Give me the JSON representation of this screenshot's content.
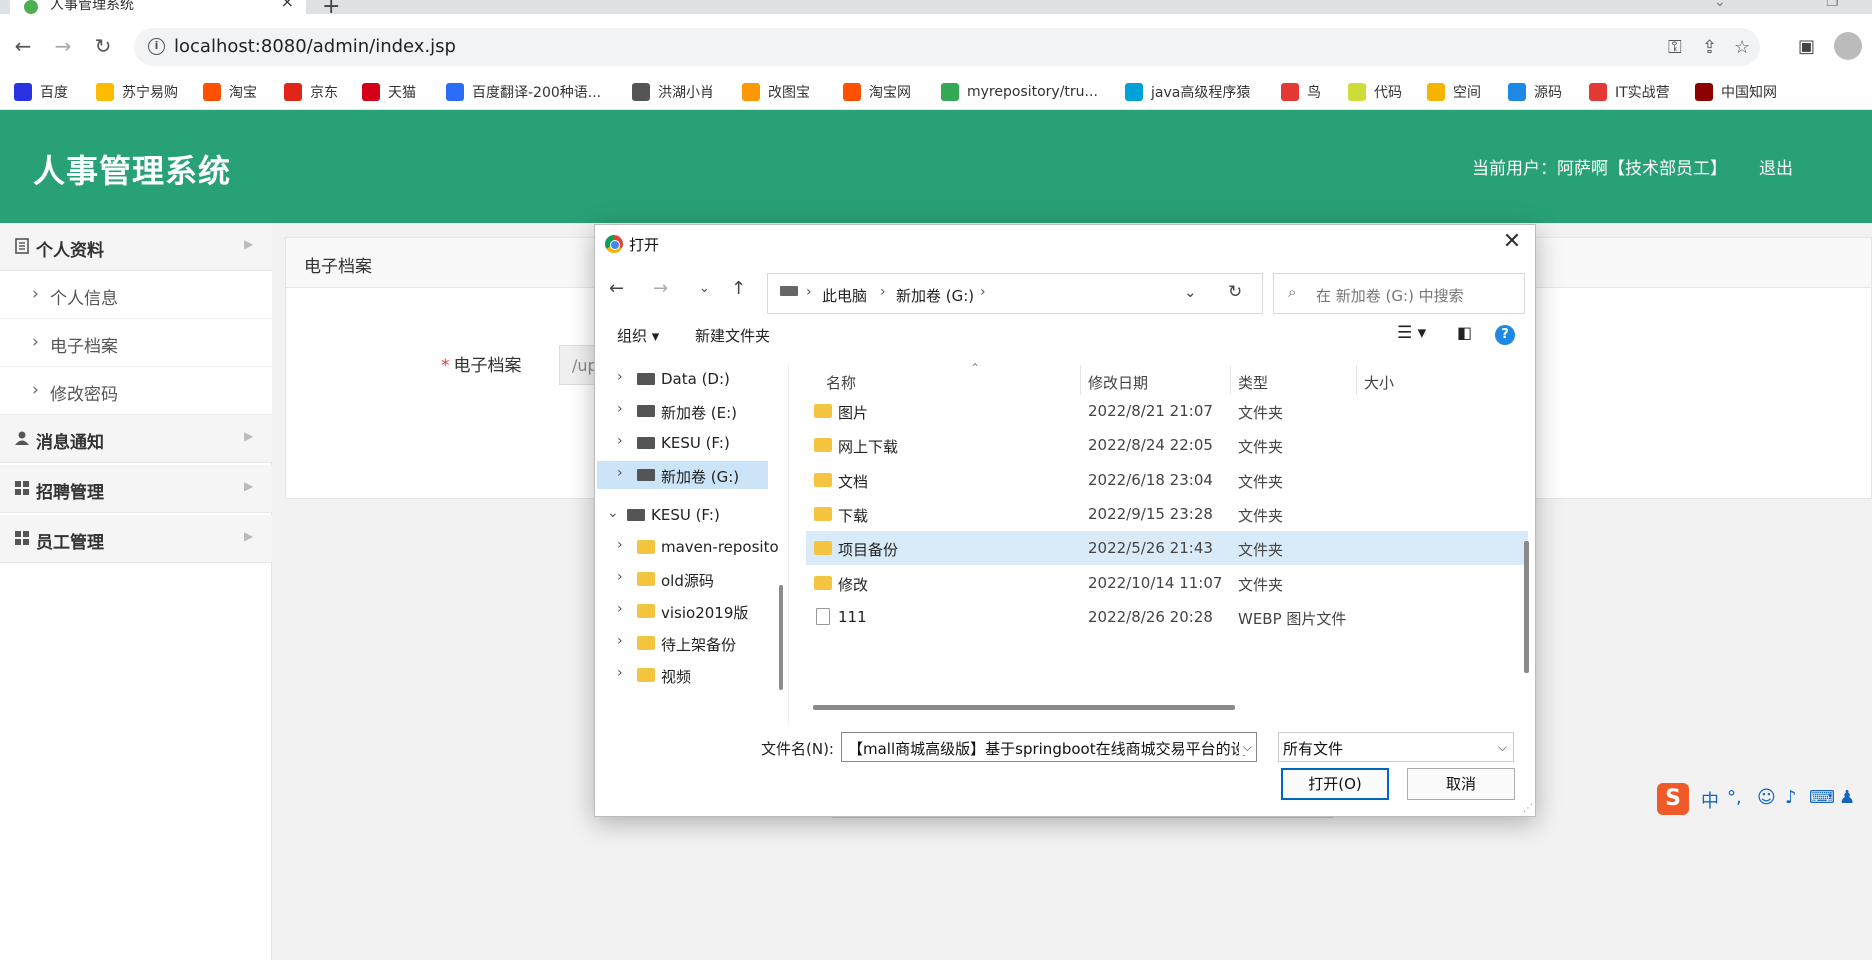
{
  "browser": {
    "tab_title": "人事管理系统",
    "tab_close": "×",
    "new_tab": "+",
    "url": "localhost:8080/admin/index.jsp",
    "bookmarks": [
      {
        "label": "百度",
        "color": "#2932e1"
      },
      {
        "label": "苏宁易购",
        "color": "#ffbb00"
      },
      {
        "label": "淘宝",
        "color": "#ff5000"
      },
      {
        "label": "京东",
        "color": "#e1251b"
      },
      {
        "label": "天猫",
        "color": "#d4001a"
      },
      {
        "label": "百度翻译-200种语...",
        "color": "#2b6cf6"
      },
      {
        "label": "洪湖小肖",
        "color": "#555555"
      },
      {
        "label": "改图宝",
        "color": "#ff9800"
      },
      {
        "label": "淘宝网",
        "color": "#ff5000"
      },
      {
        "label": "myrepository/tru...",
        "color": "#34a853"
      },
      {
        "label": "java高级程序猿",
        "color": "#00a1d6"
      },
      {
        "label": "鸟",
        "color": "#e53935"
      },
      {
        "label": "代码",
        "color": "#cddc39"
      },
      {
        "label": "空间",
        "color": "#f4b400"
      },
      {
        "label": "源码",
        "color": "#1e88e5"
      },
      {
        "label": "IT实战营",
        "color": "#e53935"
      },
      {
        "label": "中国知网",
        "color": "#8b0000"
      }
    ]
  },
  "app": {
    "title": "人事管理系统",
    "current_user": "当前用户：阿萨啊【技术部员工】",
    "logout": "退出",
    "accent": "#29a176"
  },
  "sidebar": {
    "groups": [
      {
        "label": "个人资料",
        "icon": "profile-icon"
      },
      {
        "label": "消息通知",
        "icon": "user-icon"
      },
      {
        "label": "招聘管理",
        "icon": "grid-icon"
      },
      {
        "label": "员工管理",
        "icon": "grid-icon"
      }
    ],
    "items": [
      {
        "label": "个人信息"
      },
      {
        "label": "电子档案"
      },
      {
        "label": "修改密码"
      }
    ]
  },
  "main": {
    "panel_title": "电子档案",
    "field_required_mark": "*",
    "field_label": "电子档案",
    "field_value": "/up"
  },
  "dialog": {
    "title": "打开",
    "breadcrumb": [
      "此电脑",
      "新加卷 (G:)"
    ],
    "search_placeholder": "在 新加卷 (G:) 中搜索",
    "organize": "组织 ▾",
    "new_folder": "新建文件夹",
    "help": "?",
    "tree": [
      {
        "label": "Data (D:)",
        "type": "drive",
        "level": 1
      },
      {
        "label": "新加卷 (E:)",
        "type": "drive",
        "level": 1
      },
      {
        "label": "KESU  (F:)",
        "type": "drive",
        "level": 1
      },
      {
        "label": "新加卷 (G:)",
        "type": "drive",
        "level": 1,
        "selected": true
      },
      {
        "label": "KESU  (F:)",
        "type": "drive",
        "level": 0,
        "expanded": true
      },
      {
        "label": "maven-reposito",
        "type": "folder",
        "level": 1
      },
      {
        "label": "old源码",
        "type": "folder",
        "level": 1
      },
      {
        "label": "visio2019版",
        "type": "folder",
        "level": 1
      },
      {
        "label": "待上架备份",
        "type": "folder",
        "level": 1
      },
      {
        "label": "视频",
        "type": "folder",
        "level": 1
      }
    ],
    "columns": [
      "名称",
      "修改日期",
      "类型",
      "大小"
    ],
    "files": [
      {
        "name": "图片",
        "date": "2022/8/21 21:07",
        "type": "文件夹",
        "kind": "folder"
      },
      {
        "name": "网上下载",
        "date": "2022/8/24 22:05",
        "type": "文件夹",
        "kind": "folder"
      },
      {
        "name": "文档",
        "date": "2022/6/18 23:04",
        "type": "文件夹",
        "kind": "folder"
      },
      {
        "name": "下载",
        "date": "2022/9/15 23:28",
        "type": "文件夹",
        "kind": "folder"
      },
      {
        "name": "项目备份",
        "date": "2022/5/26 21:43",
        "type": "文件夹",
        "kind": "folder",
        "selected": true
      },
      {
        "name": "修改",
        "date": "2022/10/14 11:07",
        "type": "文件夹",
        "kind": "folder"
      },
      {
        "name": "111",
        "date": "2022/8/26 20:28",
        "type": "WEBP 图片文件",
        "kind": "file"
      }
    ],
    "filename_label": "文件名(N):",
    "filename_value": "【mall商城高级版】基于springboot在线商城交易平台的设",
    "filetype_value": "所有文件",
    "open_button": "打开(O)",
    "cancel_button": "取消"
  },
  "ime": {
    "logo": "S",
    "mode": "中",
    "punct": "°,"
  }
}
